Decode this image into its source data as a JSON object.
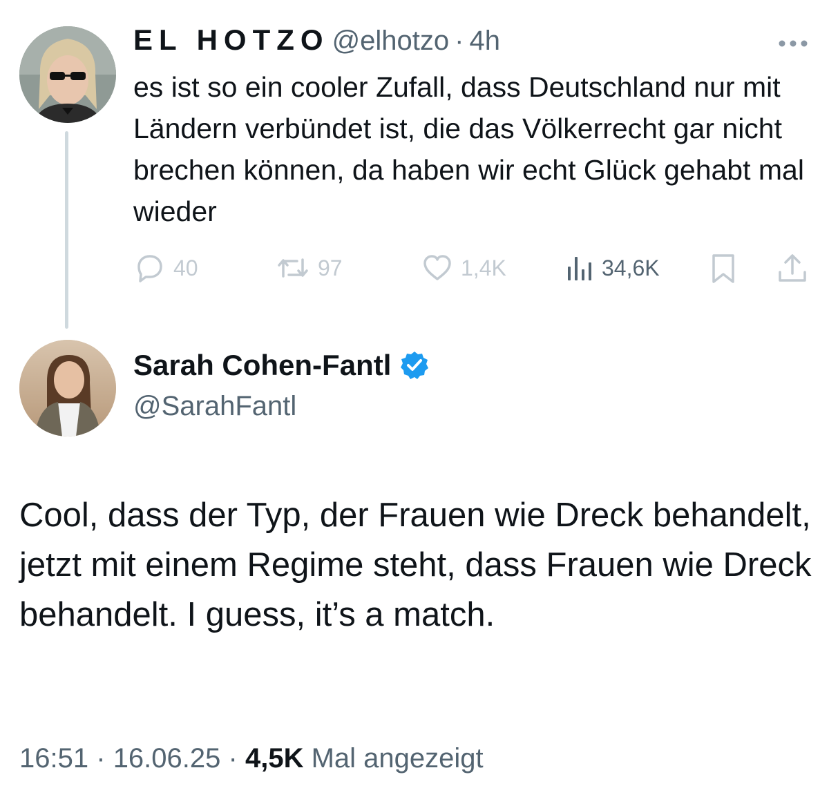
{
  "tweet1": {
    "display_name": "EL HOTZO",
    "handle": "@elhotzo",
    "separator": "·",
    "time": "4h",
    "more_icon": "more-horizontal-icon",
    "text": "es ist so ein cooler Zufall, dass Deutschland nur mit Ländern verbündet ist, die das Völkerrecht gar nicht brechen können, da haben wir echt Glück gehabt mal wieder",
    "replies": "40",
    "retweets": "97",
    "likes": "1,4K",
    "views": "34,6K"
  },
  "tweet2": {
    "display_name": "Sarah Cohen-Fantl",
    "handle": "@SarahFantl",
    "verified": true,
    "text": "Cool, dass der Typ, der Frauen wie Dreck behandelt, jetzt mit einem Regime steht, dass Frauen wie Dreck behandelt. I guess, it’s a match.",
    "time": "16:51",
    "date": "16.06.25",
    "separator": "·",
    "view_count": "4,5K",
    "view_label": "Mal angezeigt"
  },
  "colors": {
    "text_primary": "#0f1419",
    "text_secondary": "#536471",
    "faded_icon": "#c2cad1",
    "verified_blue": "#1d9bf0",
    "thread_line": "#cfd9de"
  }
}
